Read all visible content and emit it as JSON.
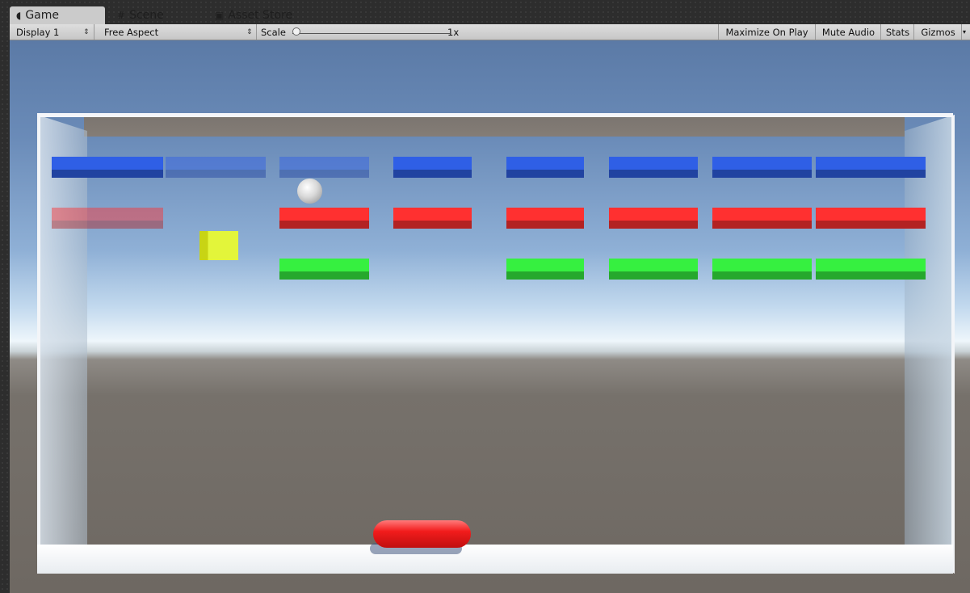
{
  "tabs": [
    {
      "icon": "pacman-icon",
      "label": "Game",
      "active": true
    },
    {
      "icon": "grid-icon",
      "label": "Scene",
      "active": false
    },
    {
      "icon": "store-bag-icon",
      "label": "Asset Store",
      "active": false
    }
  ],
  "toolbar": {
    "display": "Display 1",
    "aspect": "Free Aspect",
    "scale_label": "Scale",
    "scale_value": "1x",
    "scale_fraction": 0.0,
    "maximize": "Maximize On Play",
    "mute": "Mute Audio",
    "stats": "Stats",
    "gizmos": "Gizmos"
  },
  "scene": {
    "colors": {
      "blue": "#2f5fe6",
      "red": "#ff3030",
      "green": "#36f040",
      "yellow": "#e3f53a",
      "paddle": "#f21c1c"
    },
    "rows": [
      {
        "color": "blue",
        "bricks": [
          "solid",
          "faded",
          "faded",
          "solid",
          "solid",
          "solid",
          "solid",
          "solid"
        ]
      },
      {
        "color": "red",
        "bricks": [
          "faded",
          "none",
          "solid",
          "solid",
          "solid",
          "solid",
          "solid",
          "solid"
        ]
      },
      {
        "color": "green",
        "bricks": [
          "none",
          "none",
          "solid",
          "none",
          "solid",
          "solid",
          "solid",
          "solid"
        ]
      }
    ]
  }
}
